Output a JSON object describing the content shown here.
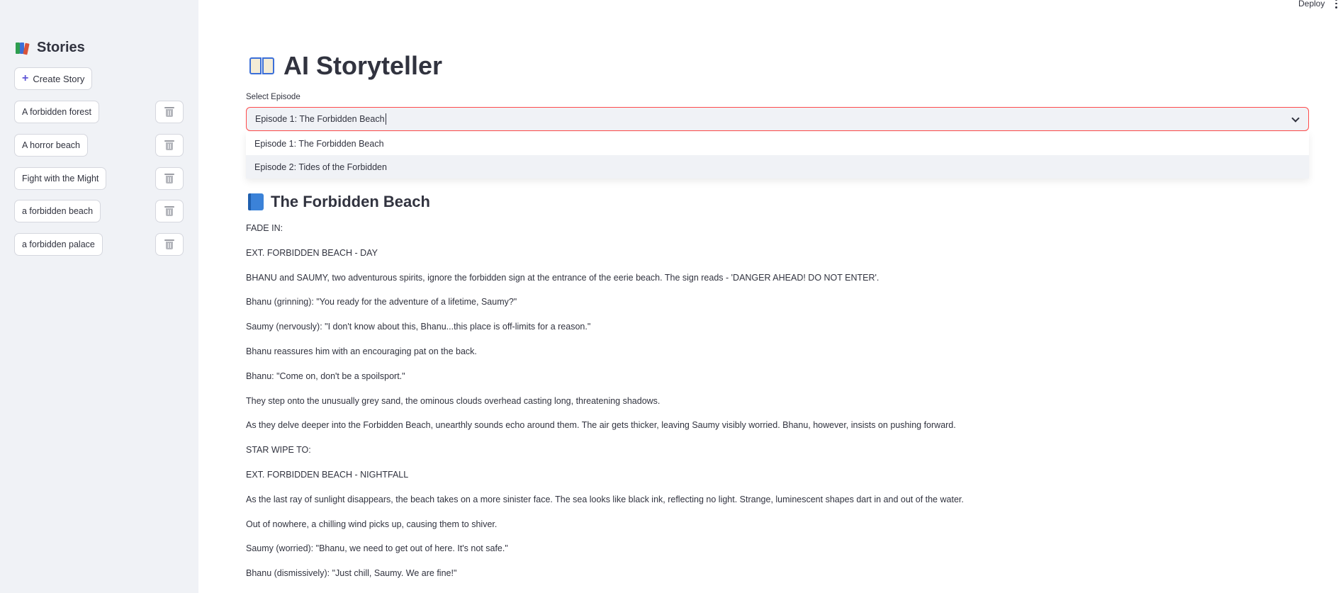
{
  "topbar": {
    "deploy_label": "Deploy",
    "menu_icon": "more-vertical-icon"
  },
  "sidebar": {
    "title": "Stories",
    "title_icon": "books-icon",
    "create_label": "Create Story",
    "stories": [
      {
        "label": "A forbidden forest"
      },
      {
        "label": "A horror beach"
      },
      {
        "label": "Fight with the Might"
      },
      {
        "label": "a forbidden beach"
      },
      {
        "label": "a forbidden palace"
      }
    ]
  },
  "main": {
    "title": "AI Storyteller",
    "title_icon": "open-book-icon",
    "select": {
      "label": "Select Episode",
      "value": "Episode 1: The Forbidden Beach",
      "options": [
        "Episode 1: The Forbidden Beach",
        "Episode 2: Tides of the Forbidden"
      ]
    },
    "episode_title": "The Forbidden Beach",
    "episode_icon": "blue-book-icon",
    "script": [
      "FADE IN:",
      "EXT. FORBIDDEN BEACH - DAY",
      "BHANU and SAUMY, two adventurous spirits, ignore the forbidden sign at the entrance of the eerie beach. The sign reads - 'DANGER AHEAD! DO NOT ENTER'.",
      "Bhanu (grinning): \"You ready for the adventure of a lifetime, Saumy?\"",
      "Saumy (nervously): \"I don't know about this, Bhanu...this place is off-limits for a reason.\"",
      "Bhanu reassures him with an encouraging pat on the back.",
      "Bhanu: \"Come on, don't be a spoilsport.\"",
      "They step onto the unusually grey sand, the ominous clouds overhead casting long, threatening shadows.",
      "As they delve deeper into the Forbidden Beach, unearthly sounds echo around them. The air gets thicker, leaving Saumy visibly worried. Bhanu, however, insists on pushing forward.",
      "STAR WIPE TO:",
      "EXT. FORBIDDEN BEACH - NIGHTFALL",
      "As the last ray of sunlight disappears, the beach takes on a more sinister face. The sea looks like black ink, reflecting no light. Strange, luminescent shapes dart in and out of the water.",
      "Out of nowhere, a chilling wind picks up, causing them to shiver.",
      "Saumy (worried): \"Bhanu, we need to get out of here. It's not safe.\"",
      "Bhanu (dismissively): \"Just chill, Saumy. We are fine!\""
    ]
  }
}
